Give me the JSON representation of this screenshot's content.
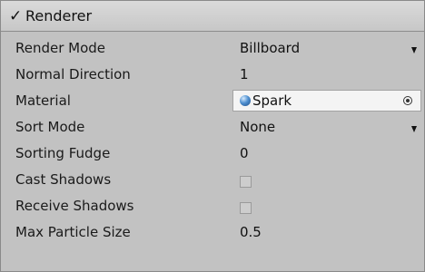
{
  "component": {
    "enabled_mark": "✓",
    "title": "Renderer"
  },
  "fields": {
    "render_mode": {
      "label": "Render Mode",
      "value": "Billboard"
    },
    "normal_direction": {
      "label": "Normal Direction",
      "value": "1"
    },
    "material": {
      "label": "Material",
      "value": "Spark"
    },
    "sort_mode": {
      "label": "Sort Mode",
      "value": "None"
    },
    "sorting_fudge": {
      "label": "Sorting Fudge",
      "value": "0"
    },
    "cast_shadows": {
      "label": "Cast Shadows",
      "checked": false
    },
    "receive_shadows": {
      "label": "Receive Shadows",
      "checked": false
    },
    "max_particle_size": {
      "label": "Max Particle Size",
      "value": "0.5"
    }
  },
  "icons": {
    "dropdown": "dropdown-arrow-icon",
    "material": "material-sphere-icon",
    "picker": "object-picker-icon"
  }
}
